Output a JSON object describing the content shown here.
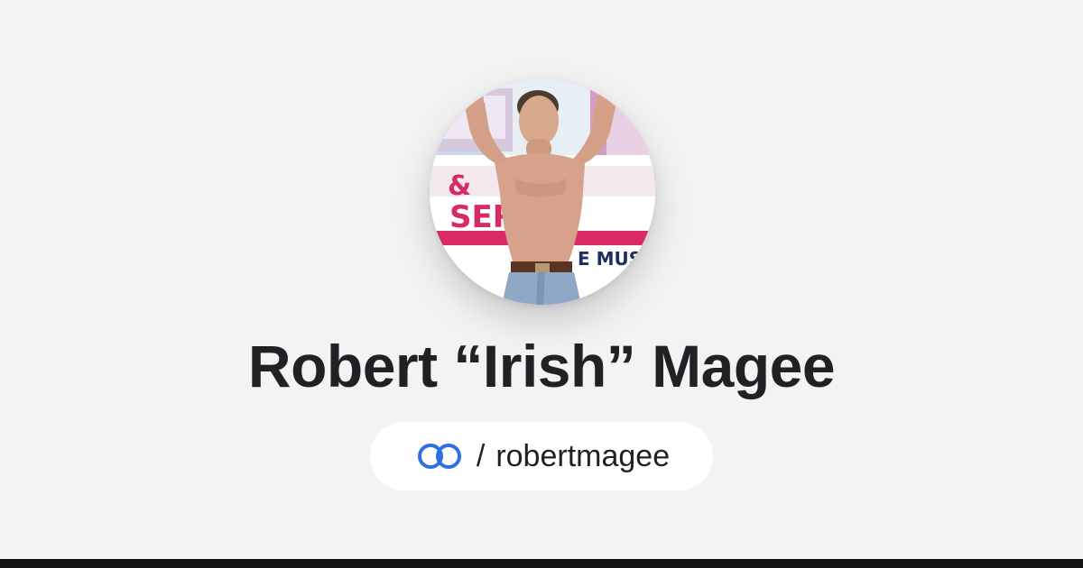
{
  "profile": {
    "name": "Robert “Irish” Magee",
    "handle_separator": "/",
    "handle": "robertmagee",
    "photo_banner_text": "SERIES",
    "photo_banner_text_top": "& ",
    "photo_banner_text_bottom": "E MUS"
  },
  "icons": {
    "brand_logo": "linked-rings-icon",
    "avatar": "avatar-photo"
  },
  "colors": {
    "background": "#f3f3f4",
    "text": "#1f2125",
    "logo_blue": "#2f6fe0",
    "pill": "#ffffff",
    "footer": "#151515"
  }
}
